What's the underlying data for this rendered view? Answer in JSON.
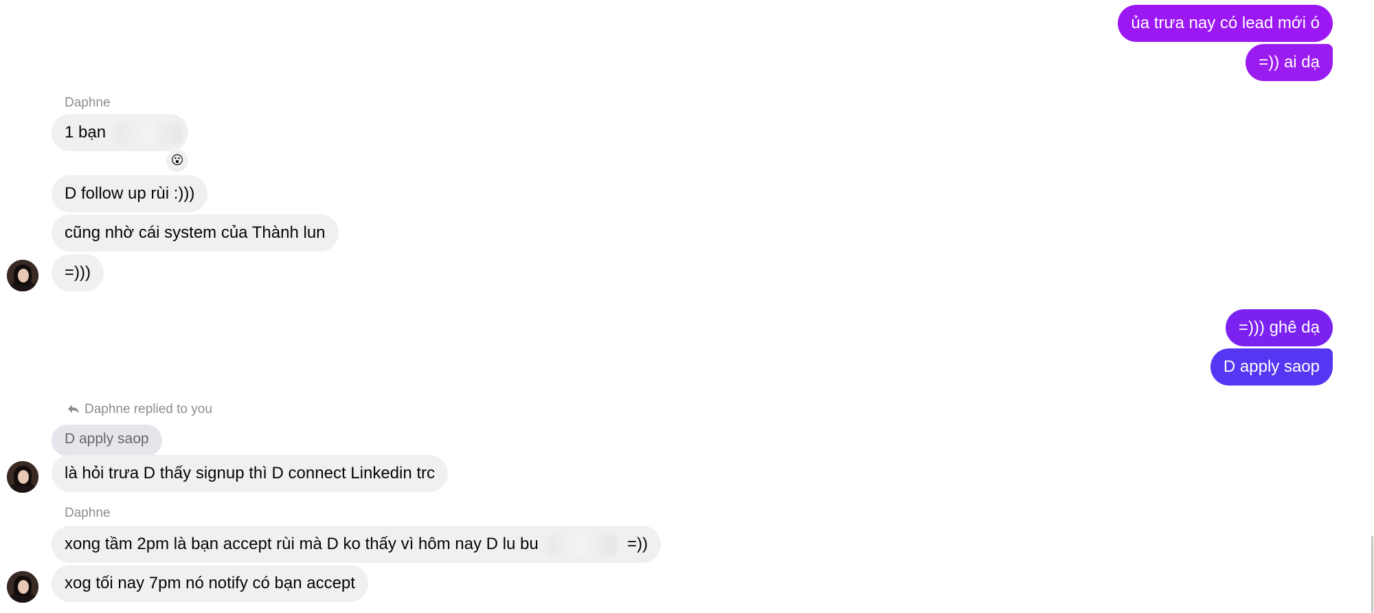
{
  "messages": {
    "out1": "ủa trưa nay có lead mới ó",
    "out2": "=)) ai dạ",
    "sender1": "Daphne",
    "in1_prefix": "1 bạn",
    "reaction": "😮",
    "in2": "D follow up rùi :)))",
    "in3": "cũng nhờ cái system của Thành lun",
    "in4": "=)))",
    "out3": "=))) ghê dạ",
    "out4": "D apply saop",
    "reply_label": "Daphne replied to you",
    "quoted": "D apply saop",
    "in5": "là hỏi trưa D thấy signup thì D connect Linkedin trc",
    "sender2": "Daphne",
    "in6_prefix": "xong tầm 2pm là bạn accept rùi mà D ko thấy vì hôm nay D lu bu",
    "in6_suffix": "=))",
    "in7": "xog tối nay 7pm nó notify có bạn accept"
  },
  "icons": {
    "reply": "reply-arrow-icon"
  },
  "colors": {
    "outgoing_top": "#9c18f2",
    "outgoing_mid": "#7b22f0",
    "outgoing_bottom": "#5436f3",
    "incoming": "#f0f0f0",
    "meta_text": "#8a8d91"
  }
}
